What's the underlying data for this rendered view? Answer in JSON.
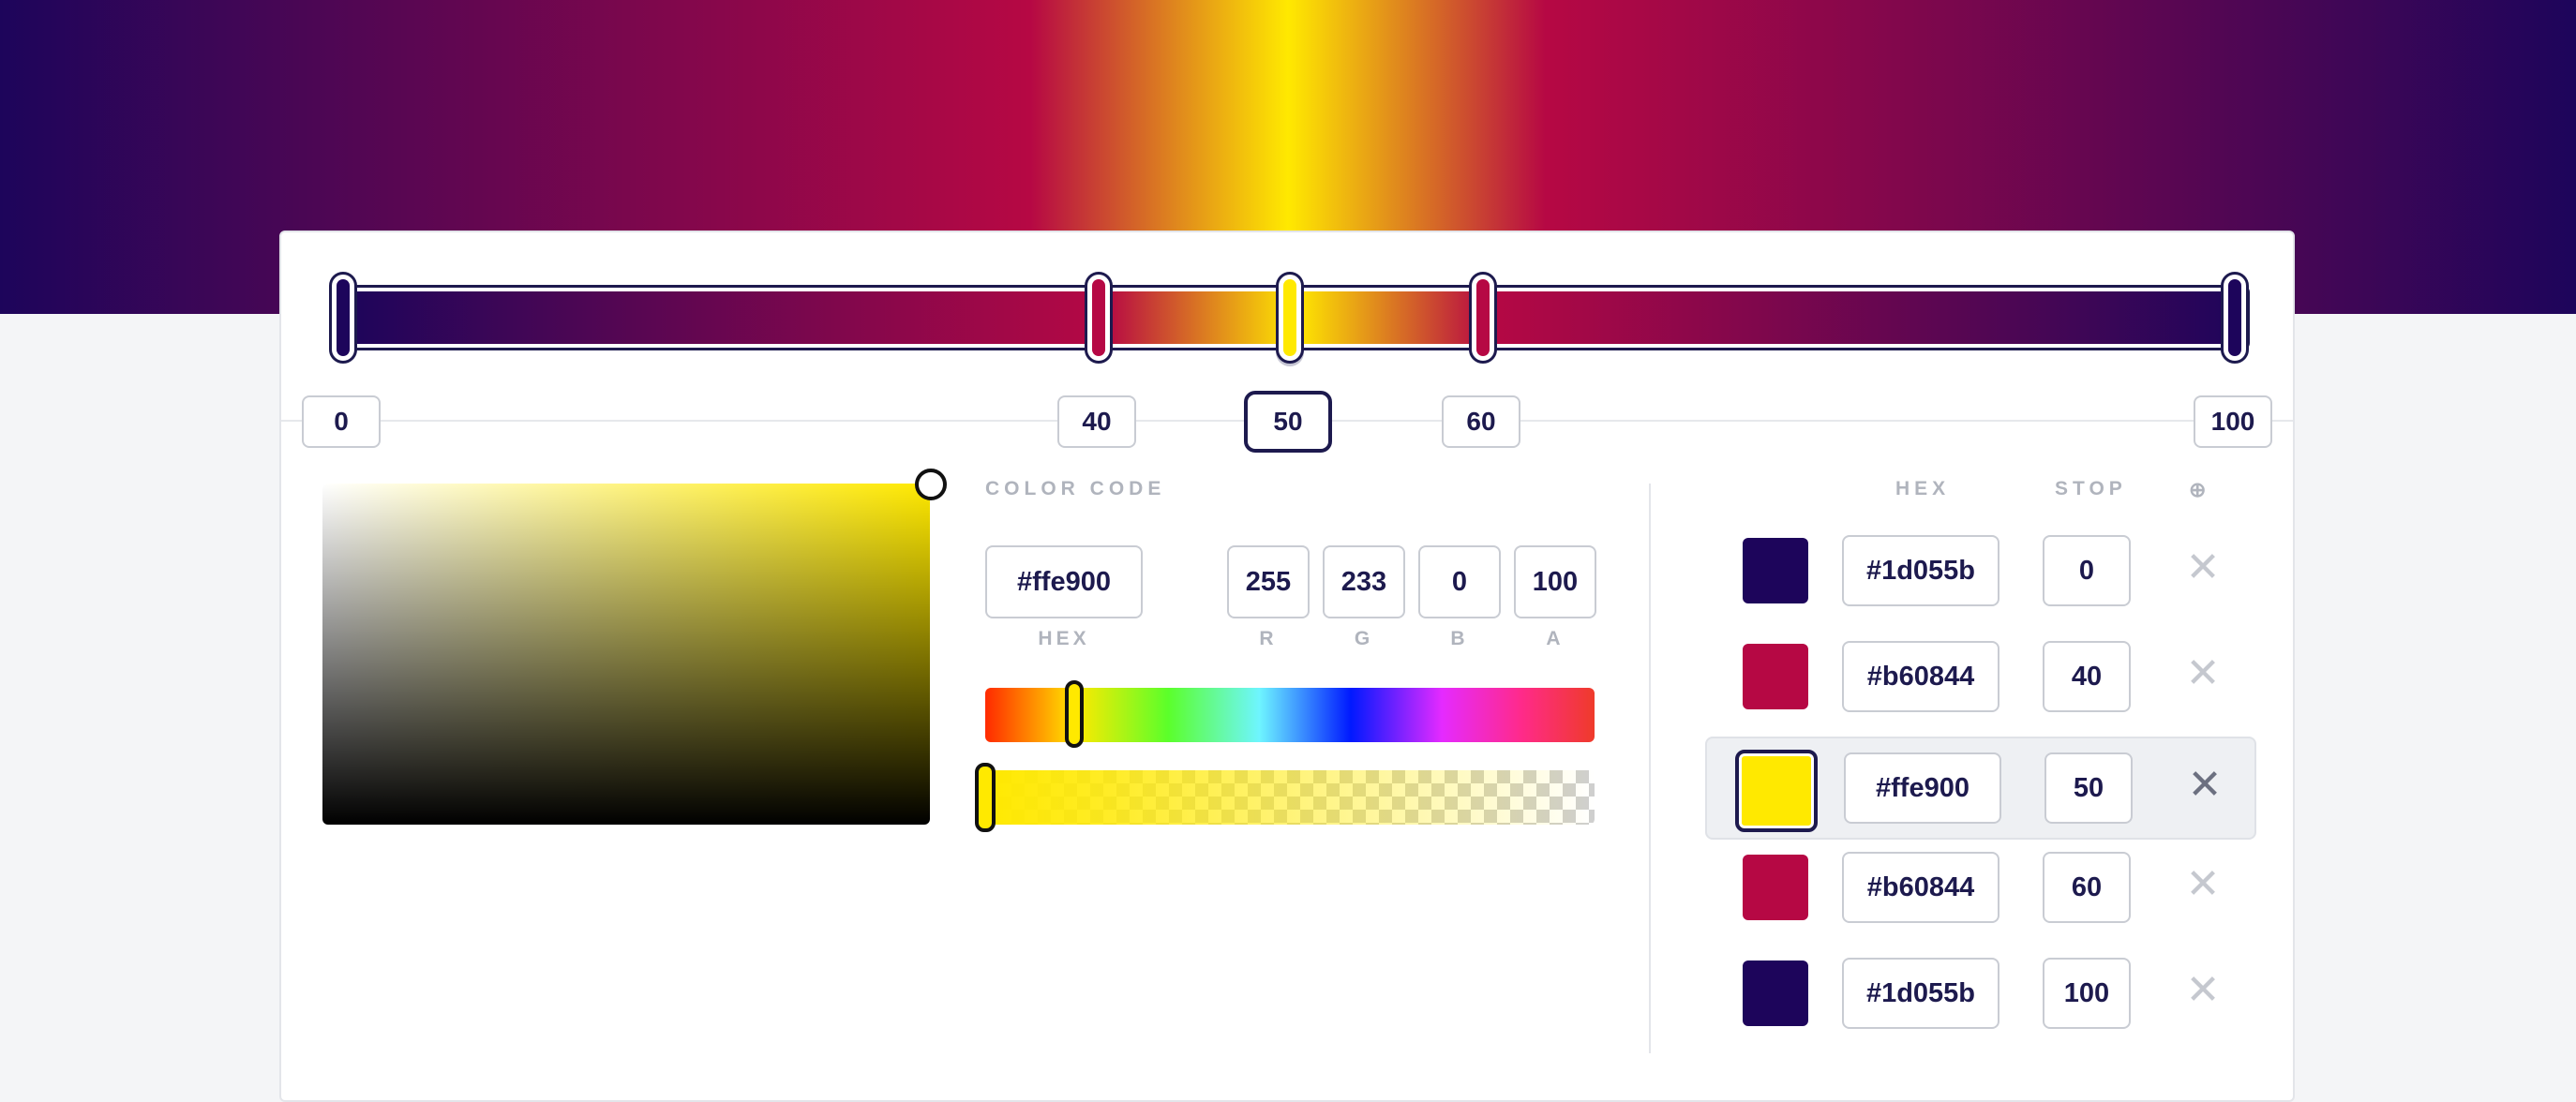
{
  "colors": {
    "stop_dark": "#1d055b",
    "stop_red": "#b60844",
    "stop_yellow": "#ffe900"
  },
  "track_stops": [
    {
      "label": "0",
      "color": "#1d055b",
      "position_pct": 0
    },
    {
      "label": "40",
      "color": "#b60844",
      "position_pct": 40
    },
    {
      "label": "50",
      "color": "#ffe900",
      "position_pct": 50,
      "active": true
    },
    {
      "label": "60",
      "color": "#b60844",
      "position_pct": 60
    },
    {
      "label": "100",
      "color": "#1d055b",
      "position_pct": 100
    }
  ],
  "color_code": {
    "heading": "COLOR CODE",
    "hex_value": "#ffe900",
    "hex_caption": "HEX",
    "r_value": "255",
    "g_value": "233",
    "b_value": "0",
    "a_value": "100",
    "r_caption": "R",
    "g_caption": "G",
    "b_caption": "B",
    "a_caption": "A"
  },
  "sliders": {
    "hue_fraction": 0.15,
    "alpha_fraction": 1.0
  },
  "stops_table": {
    "hex_header": "HEX",
    "stop_header": "STOP",
    "add_icon": "⊕",
    "remove_icon": "✕",
    "rows": [
      {
        "hex": "#1d055b",
        "stop": "0"
      },
      {
        "hex": "#b60844",
        "stop": "40"
      },
      {
        "hex": "#ffe900",
        "stop": "50",
        "active": true
      },
      {
        "hex": "#b60844",
        "stop": "60"
      },
      {
        "hex": "#1d055b",
        "stop": "100"
      }
    ]
  }
}
